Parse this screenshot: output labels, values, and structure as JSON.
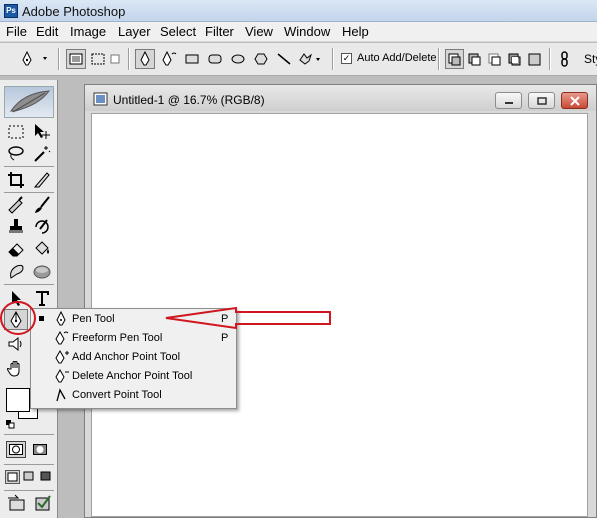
{
  "window": {
    "title": "Adobe Photoshop",
    "app_icon": "Ps"
  },
  "menu": [
    "File",
    "Edit",
    "Image",
    "Layer",
    "Select",
    "Filter",
    "View",
    "Window",
    "Help"
  ],
  "options_bar": {
    "auto_add_delete_label": "Auto Add/Delete",
    "auto_add_delete_checked": true,
    "style_label": "Sty"
  },
  "document": {
    "title": "Untitled-1 @ 16.7% (RGB/8)"
  },
  "flyout": {
    "items": [
      {
        "label": "Pen Tool",
        "shortcut": "P",
        "icon": "pen-icon",
        "selected": true
      },
      {
        "label": "Freeform Pen Tool",
        "shortcut": "P",
        "icon": "freeform-pen-icon",
        "selected": false
      },
      {
        "label": "Add Anchor Point Tool",
        "shortcut": "",
        "icon": "add-anchor-point-icon",
        "selected": false
      },
      {
        "label": "Delete Anchor Point Tool",
        "shortcut": "",
        "icon": "delete-anchor-point-icon",
        "selected": false
      },
      {
        "label": "Convert Point Tool",
        "shortcut": "",
        "icon": "convert-point-icon",
        "selected": false
      }
    ]
  },
  "annotation": {
    "color": "#d0161f"
  }
}
